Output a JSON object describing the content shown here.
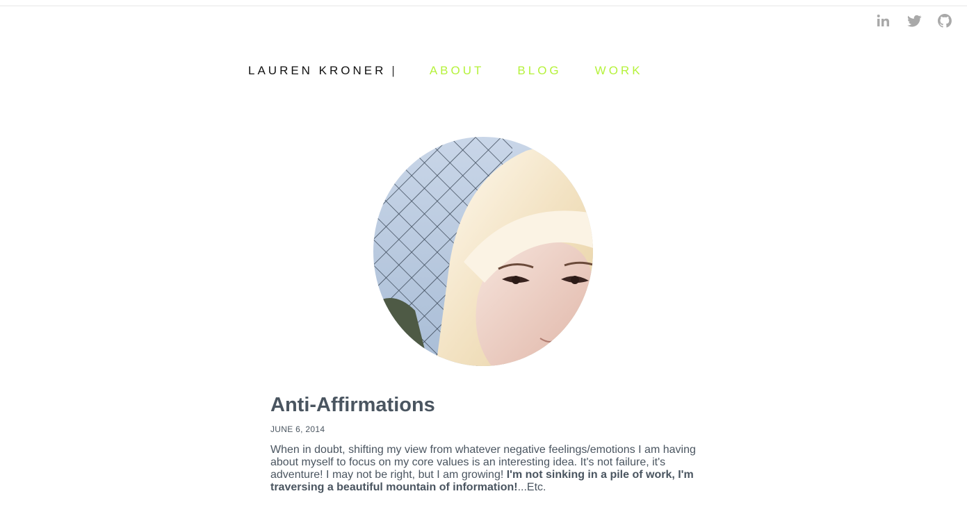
{
  "social": {
    "items": [
      {
        "name": "linkedin",
        "label": "in"
      },
      {
        "name": "twitter",
        "label": ""
      },
      {
        "name": "github",
        "label": ""
      }
    ],
    "icon_color": "#a9a9a9"
  },
  "nav": {
    "brand": "LAUREN KRONER",
    "separator": "|",
    "links": [
      "ABOUT",
      "BLOG",
      "WORK"
    ],
    "link_color": "#b5f23a"
  },
  "post": {
    "title": "Anti-Affirmations",
    "date": "JUNE 6, 2014",
    "body_part1": "When in doubt, shifting my view from whatever negative feelings/emotions I am having about myself to focus on my core values is an interesting idea. It's not failure, it's adventure! I may not be right, but I am growing! ",
    "body_bold": "I'm not sinking in a pile of work, I'm traversing a beautiful mountain of information!",
    "body_part2": "...Etc.",
    "text_color": "#4a5560"
  }
}
